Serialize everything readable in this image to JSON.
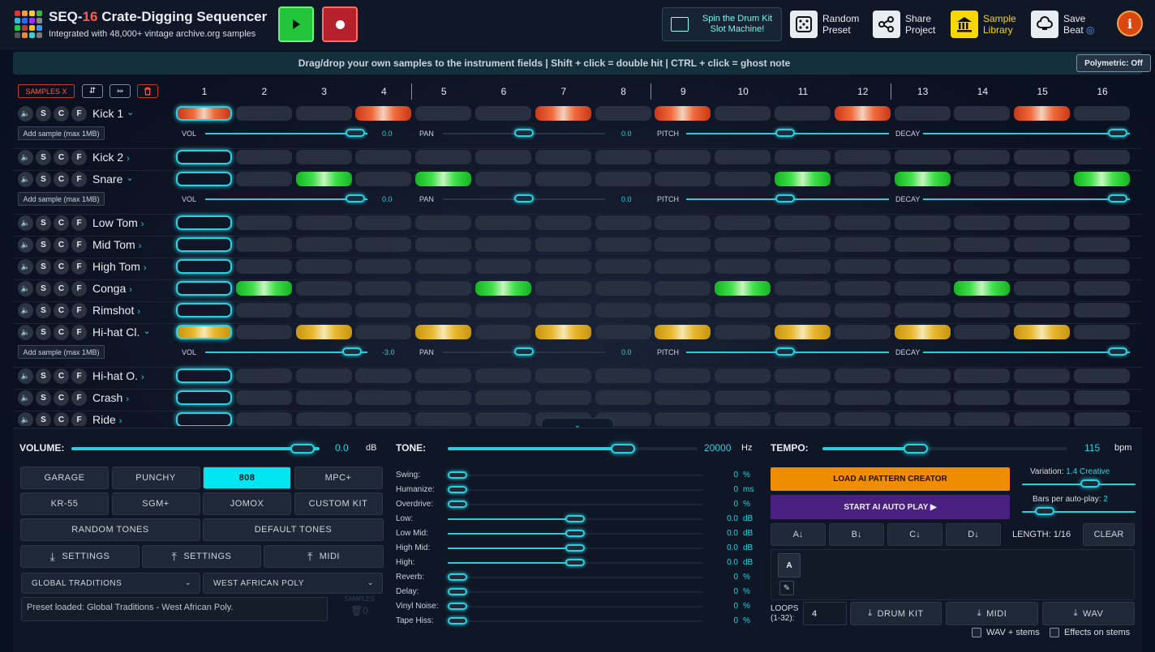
{
  "app": {
    "title_prefix": "SEQ-",
    "title_num": "16",
    "title_rest": " Crate-Digging Sequencer",
    "subtitle": "Integrated with 48,000+ vintage archive.org samples"
  },
  "header": {
    "slot_machine": "Spin the Drum Kit Slot Machine!",
    "random_preset_1": "Random",
    "random_preset_2": "Preset",
    "share_1": "Share",
    "share_2": "Project",
    "library_1": "Sample",
    "library_2": "Library",
    "save_1": "Save",
    "save_2": "Beat",
    "info": "i"
  },
  "hint": {
    "text": "Drag/drop your own samples to the instrument fields | Shift + click = double hit | CTRL + click = ghost note",
    "polymetric": "Polymetric: Off"
  },
  "grid_controls": {
    "samples_x": "SAMPLES X",
    "steps": [
      "1",
      "2",
      "3",
      "4",
      "5",
      "6",
      "7",
      "8",
      "9",
      "10",
      "11",
      "12",
      "13",
      "14",
      "15",
      "16"
    ]
  },
  "track_buttons": [
    "S",
    "C",
    "F"
  ],
  "add_sample_label": "Add sample (max 1MB)",
  "param_labels": {
    "vol": "VOL",
    "pan": "PAN",
    "pitch": "PITCH",
    "decay": "DECAY"
  },
  "tracks": [
    {
      "name": "Kick 1",
      "expanded": true,
      "color": "red",
      "steps": [
        1,
        0,
        0,
        1,
        0,
        0,
        1,
        0,
        1,
        0,
        0,
        1,
        0,
        0,
        1,
        0
      ],
      "vol_value": "0.0",
      "pan_value": "0.0"
    },
    {
      "name": "Kick 2",
      "expanded": false,
      "color": "red",
      "steps": [
        0,
        0,
        0,
        0,
        0,
        0,
        0,
        0,
        0,
        0,
        0,
        0,
        0,
        0,
        0,
        0
      ]
    },
    {
      "name": "Snare",
      "expanded": true,
      "color": "green",
      "steps": [
        0,
        0,
        1,
        0,
        1,
        0,
        0,
        0,
        0,
        0,
        1,
        0,
        1,
        0,
        0,
        1
      ],
      "vol_value": "0.0",
      "pan_value": "0.0"
    },
    {
      "name": "Low Tom",
      "expanded": false,
      "color": "green",
      "steps": [
        0,
        0,
        0,
        0,
        0,
        0,
        0,
        0,
        0,
        0,
        0,
        0,
        0,
        0,
        0,
        0
      ]
    },
    {
      "name": "Mid Tom",
      "expanded": false,
      "color": "green",
      "steps": [
        0,
        0,
        0,
        0,
        0,
        0,
        0,
        0,
        0,
        0,
        0,
        0,
        0,
        0,
        0,
        0
      ]
    },
    {
      "name": "High Tom",
      "expanded": false,
      "color": "green",
      "steps": [
        0,
        0,
        0,
        0,
        0,
        0,
        0,
        0,
        0,
        0,
        0,
        0,
        0,
        0,
        0,
        0
      ]
    },
    {
      "name": "Conga",
      "expanded": false,
      "color": "green",
      "steps": [
        0,
        1,
        0,
        0,
        0,
        1,
        0,
        0,
        0,
        1,
        0,
        0,
        0,
        1,
        0,
        0
      ]
    },
    {
      "name": "Rimshot",
      "expanded": false,
      "color": "green",
      "steps": [
        0,
        0,
        0,
        0,
        0,
        0,
        0,
        0,
        0,
        0,
        0,
        0,
        0,
        0,
        0,
        0
      ]
    },
    {
      "name": "Hi-hat Cl.",
      "expanded": true,
      "color": "gold",
      "steps": [
        1,
        0,
        1,
        0,
        1,
        0,
        1,
        0,
        1,
        0,
        1,
        0,
        1,
        0,
        1,
        0
      ],
      "vol_value": "-3.0",
      "pan_value": "0.0"
    },
    {
      "name": "Hi-hat O.",
      "expanded": false,
      "color": "gold",
      "steps": [
        0,
        0,
        0,
        0,
        0,
        0,
        0,
        0,
        0,
        0,
        0,
        0,
        0,
        0,
        0,
        0
      ]
    },
    {
      "name": "Crash",
      "expanded": false,
      "color": "gold",
      "steps": [
        0,
        0,
        0,
        0,
        0,
        0,
        0,
        0,
        0,
        0,
        0,
        0,
        0,
        0,
        0,
        0
      ]
    },
    {
      "name": "Ride",
      "expanded": false,
      "color": "gold",
      "steps": [
        0,
        0,
        0,
        0,
        0,
        0,
        0,
        0,
        0,
        0,
        0,
        0,
        0,
        0,
        0,
        0
      ]
    }
  ],
  "volume": {
    "label": "VOLUME:",
    "value": "0.0",
    "unit": "dB",
    "level": 0.93
  },
  "kits": {
    "row1": [
      "GARAGE",
      "PUNCHY",
      "808",
      "MPC+"
    ],
    "row2": [
      "KR-55",
      "SGM+",
      "JOMOX",
      "CUSTOM KIT"
    ],
    "random_tones": "RANDOM TONES",
    "default_tones": "DEFAULT TONES",
    "settings_down": "SETTINGS",
    "settings_up": "SETTINGS",
    "midi": "MIDI",
    "genre": "GLOBAL TRADITIONS",
    "style": "WEST AFRICAN POLY",
    "status": "Preset loaded: Global Traditions - West African Poly.",
    "samples_label": "SAMPLES",
    "samples_count": "0"
  },
  "tone": {
    "label": "TONE:",
    "value": "20000",
    "unit": "Hz",
    "level": 0.7,
    "params": [
      {
        "name": "Swing:",
        "value": "0",
        "unit": "%",
        "level": 0.0
      },
      {
        "name": "Humanize:",
        "value": "0",
        "unit": "ms",
        "level": 0.0
      },
      {
        "name": "Overdrive:",
        "value": "0",
        "unit": "%",
        "level": 0.0
      },
      {
        "name": "Low:",
        "value": "0.0",
        "unit": "dB",
        "level": 0.5
      },
      {
        "name": "Low Mid:",
        "value": "0.0",
        "unit": "dB",
        "level": 0.5
      },
      {
        "name": "High Mid:",
        "value": "0.0",
        "unit": "dB",
        "level": 0.5
      },
      {
        "name": "High:",
        "value": "0.0",
        "unit": "dB",
        "level": 0.5
      },
      {
        "name": "Reverb:",
        "value": "0",
        "unit": "%",
        "level": 0.0
      },
      {
        "name": "Delay:",
        "value": "0",
        "unit": "%",
        "level": 0.0
      },
      {
        "name": "Vinyl Noise:",
        "value": "0",
        "unit": "%",
        "level": 0.0
      },
      {
        "name": "Tape Hiss:",
        "value": "0",
        "unit": "%",
        "level": 0.0
      }
    ]
  },
  "tempo": {
    "label": "TEMPO:",
    "value": "115",
    "unit": "bpm",
    "level": 0.38
  },
  "ai": {
    "load": "LOAD AI PATTERN CREATOR",
    "auto": "START AI AUTO PLAY ▶",
    "variation_label": "Variation:",
    "variation_value": "1.4",
    "variation_mode": "Creative",
    "variation_level": 0.6,
    "bars_label": "Bars per auto-play:",
    "bars_value": "2",
    "bars_level": 0.2
  },
  "patterns": {
    "buttons": [
      "A↓",
      "B↓",
      "C↓",
      "D↓"
    ],
    "length_label": "LENGTH: 1/16",
    "clear": "CLEAR",
    "current": "A"
  },
  "export": {
    "loops_label": "LOOPS (1-32):",
    "loops_value": "4",
    "drum_kit": "DRUM KIT",
    "midi": "MIDI",
    "wav": "WAV",
    "wav_stems": "WAV + stems",
    "effects_stems": "Effects on stems"
  },
  "colors": {
    "accent": "#2ad0df",
    "kick": "#f06a3a",
    "snare": "#3fe04a",
    "hihat": "#e8b72d"
  }
}
